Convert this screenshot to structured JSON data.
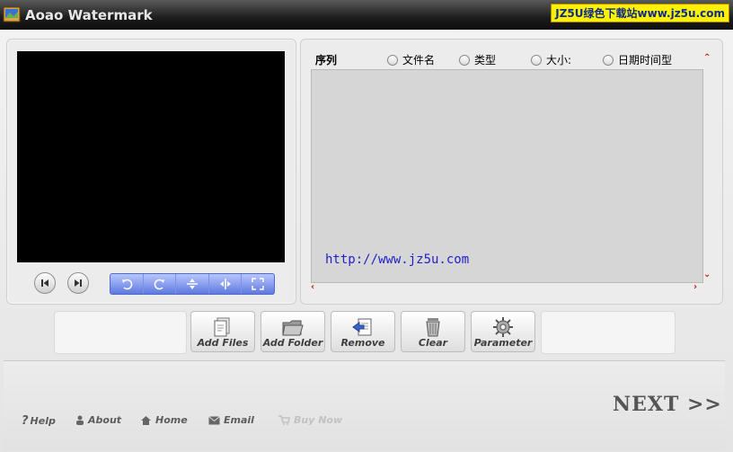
{
  "window": {
    "title": "Aoao Watermark",
    "watermark_badge": "JZ5U绿色下载站www.jz5u.com"
  },
  "preview": {
    "prev_icon": "skip-back-icon",
    "next_icon": "skip-forward-icon",
    "tools": [
      {
        "name": "rotate-left-icon"
      },
      {
        "name": "rotate-right-icon"
      },
      {
        "name": "flip-vertical-icon"
      },
      {
        "name": "flip-horizontal-icon"
      },
      {
        "name": "fullscreen-icon"
      }
    ]
  },
  "file_list": {
    "columns": {
      "index": "序列",
      "filename": "文件名",
      "type": "类型",
      "size": "大小:",
      "datetime": "日期时间型"
    },
    "rows": [],
    "overlay_url": "http://www.jz5u.com"
  },
  "actions": {
    "add_files": "Add Files",
    "add_folder": "Add Folder",
    "remove": "Remove",
    "clear": "Clear",
    "parameter": "Parameter"
  },
  "footer": {
    "help": "Help",
    "about": "About",
    "home": "Home",
    "email": "Email",
    "buy_now": "Buy Now",
    "next": "NEXT >>"
  },
  "colors": {
    "accent_blue": "#5f79de",
    "url_blue": "#1f1fc8",
    "scroll_arrow_red": "#c21a1a",
    "badge_yellow": "#fff200"
  }
}
